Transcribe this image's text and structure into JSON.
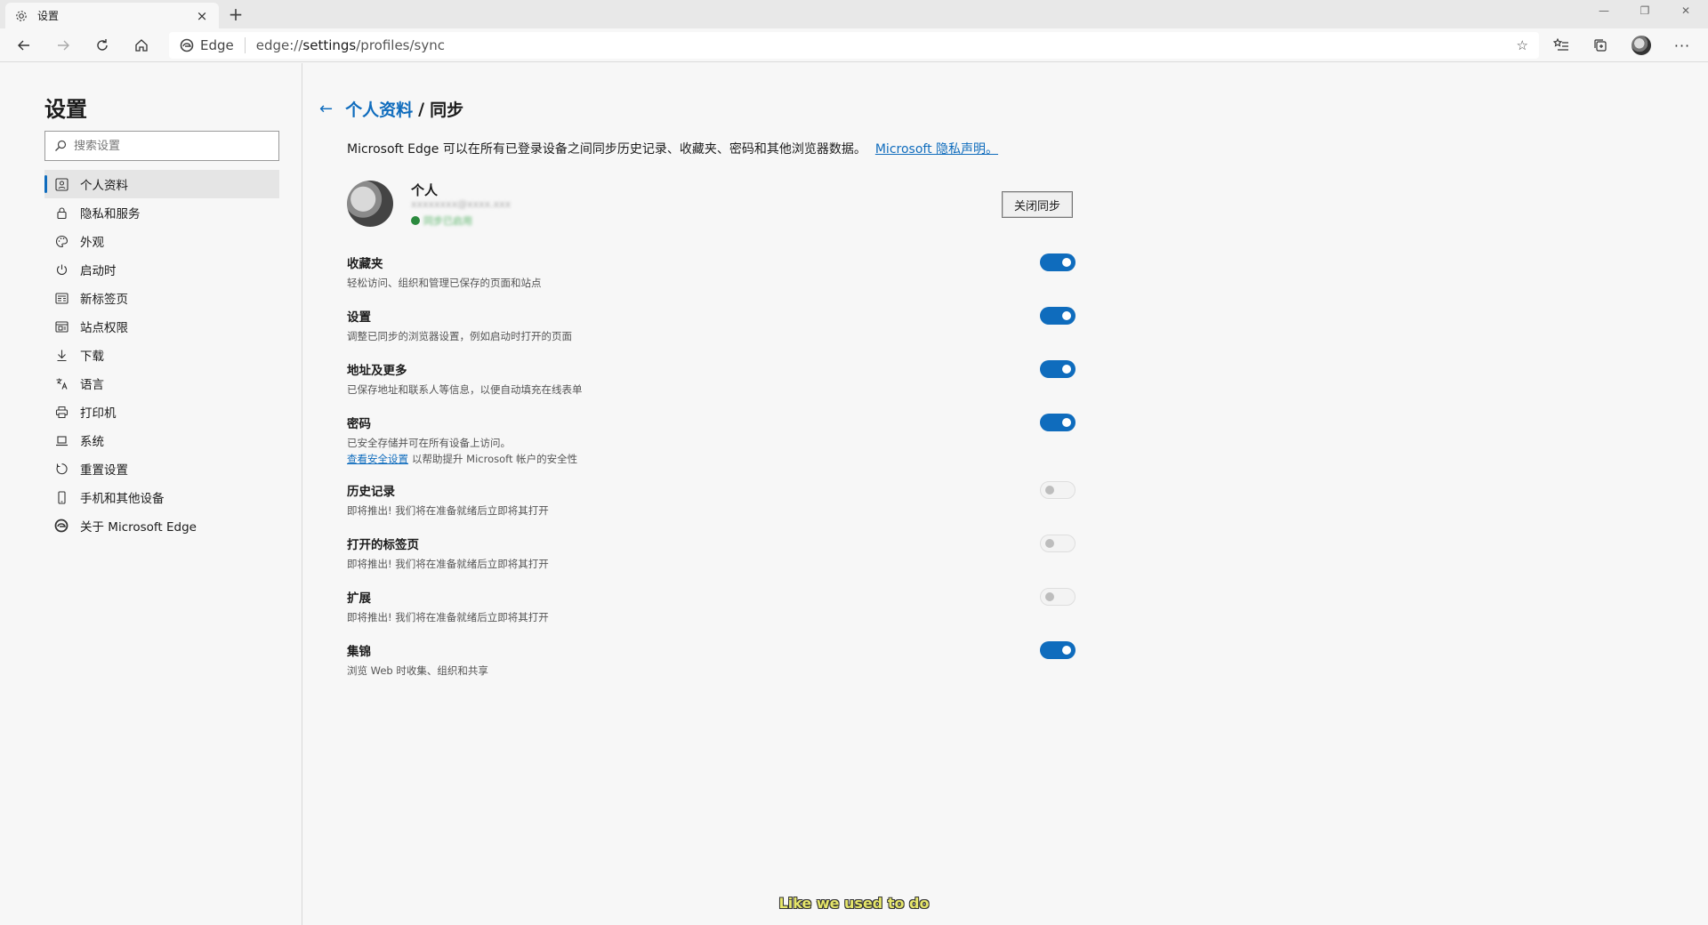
{
  "tab": {
    "title": "设置",
    "icon": "gear-icon"
  },
  "toolbar": {
    "edge_label": "Edge",
    "url_prefix": "edge://",
    "url_main": "settings",
    "url_rest": "/profiles/sync"
  },
  "sidebar": {
    "title": "设置",
    "search_placeholder": "搜索设置",
    "items": [
      {
        "label": "个人资料",
        "icon": "profile-icon",
        "active": true
      },
      {
        "label": "隐私和服务",
        "icon": "lock-icon"
      },
      {
        "label": "外观",
        "icon": "palette-icon"
      },
      {
        "label": "启动时",
        "icon": "power-icon"
      },
      {
        "label": "新标签页",
        "icon": "newtab-icon"
      },
      {
        "label": "站点权限",
        "icon": "site-permissions-icon"
      },
      {
        "label": "下载",
        "icon": "download-icon"
      },
      {
        "label": "语言",
        "icon": "language-icon"
      },
      {
        "label": "打印机",
        "icon": "printer-icon"
      },
      {
        "label": "系统",
        "icon": "laptop-icon"
      },
      {
        "label": "重置设置",
        "icon": "reset-icon"
      },
      {
        "label": "手机和其他设备",
        "icon": "phone-icon"
      },
      {
        "label": "关于 Microsoft Edge",
        "icon": "edge-logo-icon"
      }
    ]
  },
  "main": {
    "breadcrumb_parent": "个人资料",
    "breadcrumb_sep": "/",
    "breadcrumb_current": "同步",
    "intro_text": "Microsoft Edge 可以在所有已登录设备之间同步历史记录、收藏夹、密码和其他浏览器数据。",
    "intro_link": "Microsoft 隐私声明。",
    "profile": {
      "name": "个人",
      "email": "xxxxxxxx@xxxx.xxx",
      "status": "同步已启用",
      "turn_off_label": "关闭同步"
    },
    "sync_items": [
      {
        "title": "收藏夹",
        "desc": "轻松访问、组织和管理已保存的页面和站点",
        "on": true
      },
      {
        "title": "设置",
        "desc": "调整已同步的浏览器设置，例如启动时打开的页面",
        "on": true
      },
      {
        "title": "地址及更多",
        "desc": "已保存地址和联系人等信息，以便自动填充在线表单",
        "on": true
      },
      {
        "title": "密码",
        "desc": "已安全存储并可在所有设备上访问。",
        "desc2_link": "查看安全设置",
        "desc2_text": "以帮助提升 Microsoft 帐户的安全性",
        "on": true
      },
      {
        "title": "历史记录",
        "desc": "即将推出! 我们将在准备就绪后立即将其打开",
        "on": false
      },
      {
        "title": "打开的标签页",
        "desc": "即将推出! 我们将在准备就绪后立即将其打开",
        "on": false
      },
      {
        "title": "扩展",
        "desc": "即将推出! 我们将在准备就绪后立即将其打开",
        "on": false
      },
      {
        "title": "集锦",
        "desc": "浏览 Web 时收集、组织和共享",
        "on": true
      }
    ]
  },
  "caption": "Like we used to do",
  "colors": {
    "accent": "#0f6cbd",
    "sync_ok": "#2b8a3e"
  }
}
